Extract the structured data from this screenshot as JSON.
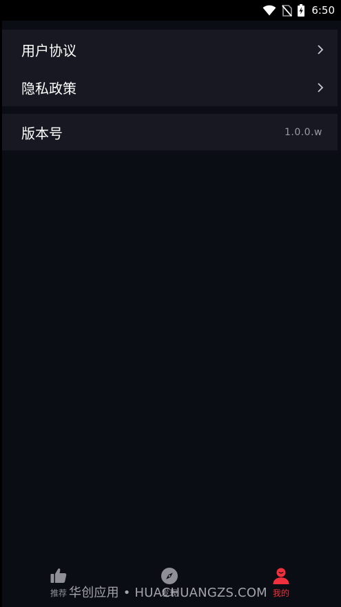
{
  "status_bar": {
    "time": "6:50",
    "icons": [
      "wifi-icon",
      "no-sim-icon",
      "battery-charging-icon"
    ]
  },
  "settings": {
    "items": [
      {
        "label": "用户协议",
        "icon": "chevron-right-icon"
      },
      {
        "label": "隐私政策",
        "icon": "chevron-right-icon"
      }
    ],
    "version": {
      "label": "版本号",
      "value": "1.0.0.w"
    }
  },
  "tabbar": {
    "tabs": [
      {
        "label": "推荐",
        "icon": "thumbs-up-icon",
        "active": false
      },
      {
        "label": "发现",
        "icon": "compass-icon",
        "active": false
      },
      {
        "label": "我的",
        "icon": "user-icon",
        "active": true
      }
    ]
  },
  "watermark": {
    "text": "华创应用 • HUACHUANGZS.COM"
  },
  "colors": {
    "background": "#0b0d14",
    "card": "#171822",
    "accent": "#f1303d",
    "inactive": "#8e8f97",
    "secondary_text": "#9a9ba4"
  }
}
